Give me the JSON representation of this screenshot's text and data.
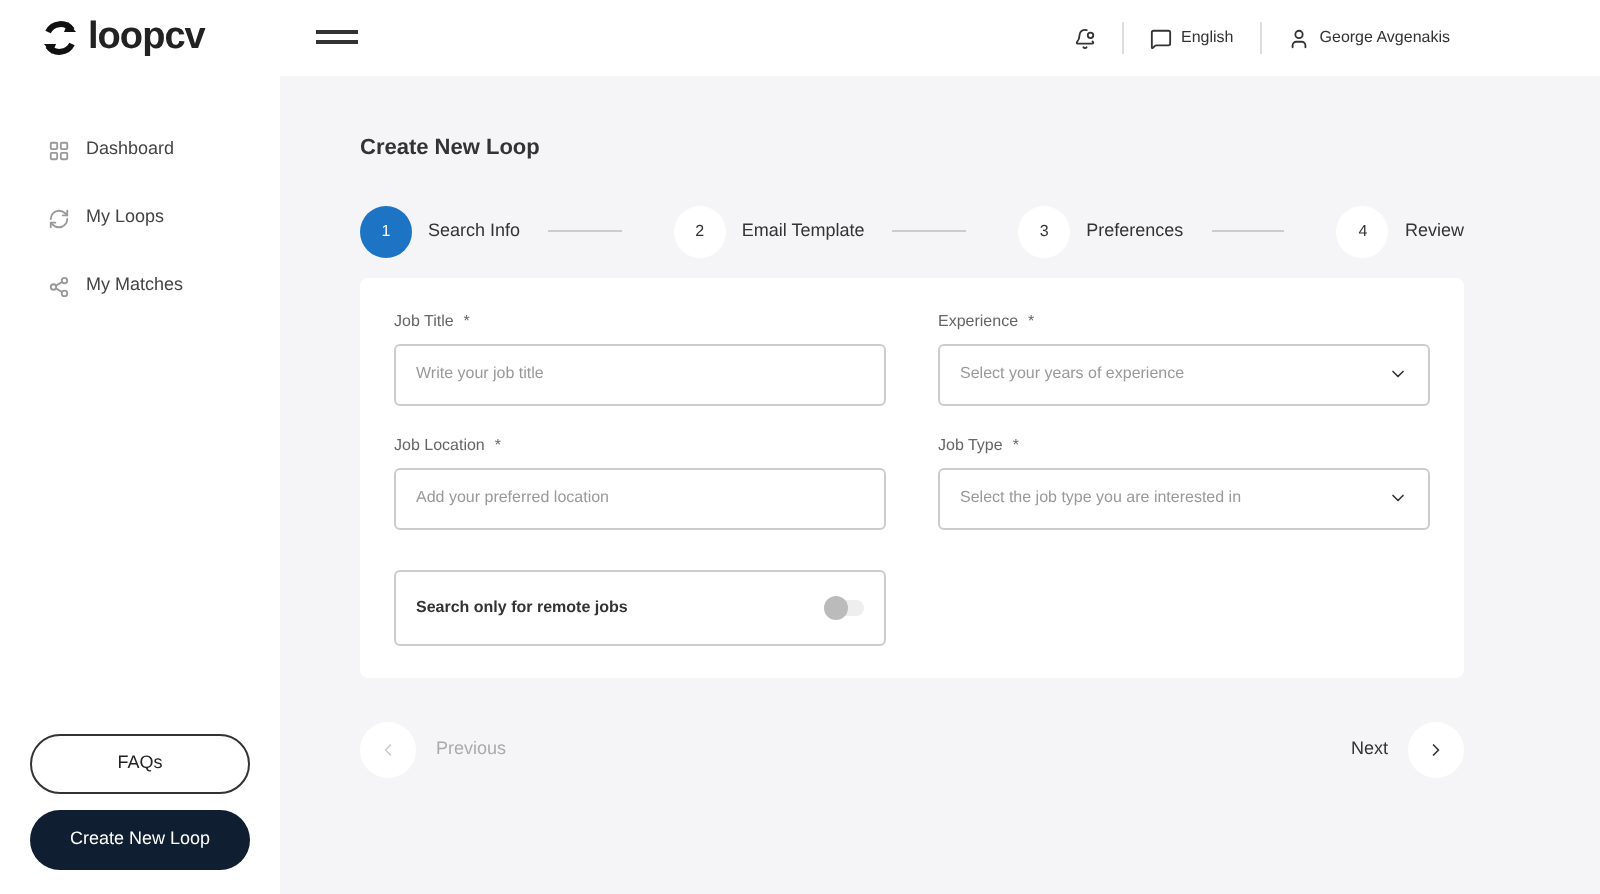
{
  "brand": {
    "name": "loopcv"
  },
  "header": {
    "language": "English",
    "user": "George Avgenakis"
  },
  "sidebar": {
    "items": [
      {
        "label": "Dashboard",
        "selected": false
      },
      {
        "label": "My Loops",
        "selected": false
      },
      {
        "label": "My Matches",
        "selected": false
      }
    ],
    "buttons": [
      {
        "label": "FAQs",
        "kind": "outline"
      },
      {
        "label": "Create New Loop",
        "kind": "filled"
      }
    ]
  },
  "page": {
    "title": "Create New Loop"
  },
  "steps": [
    {
      "number": "1",
      "label": "Search Info",
      "selected": true
    },
    {
      "number": "2",
      "label": "Email Template",
      "selected": false
    },
    {
      "number": "3",
      "label": "Preferences",
      "selected": false
    },
    {
      "number": "4",
      "label": "Review",
      "selected": false
    }
  ],
  "fields": [
    {
      "label": "Job Title",
      "required_mark": "*",
      "kind": "text",
      "placeholder": "Write your job title"
    },
    {
      "label": "Experience",
      "required_mark": "*",
      "kind": "select",
      "placeholder": "Select your years of experience"
    },
    {
      "label": "Job Location",
      "required_mark": "*",
      "kind": "text",
      "placeholder": "Add your preferred location"
    },
    {
      "label": "Job Type",
      "required_mark": "*",
      "kind": "select",
      "placeholder": "Select the job type you are interested in"
    }
  ],
  "remote_toggle": {
    "label": "Search only for remote jobs",
    "on": false
  },
  "nav": {
    "previous": "Previous",
    "next": "Next"
  }
}
